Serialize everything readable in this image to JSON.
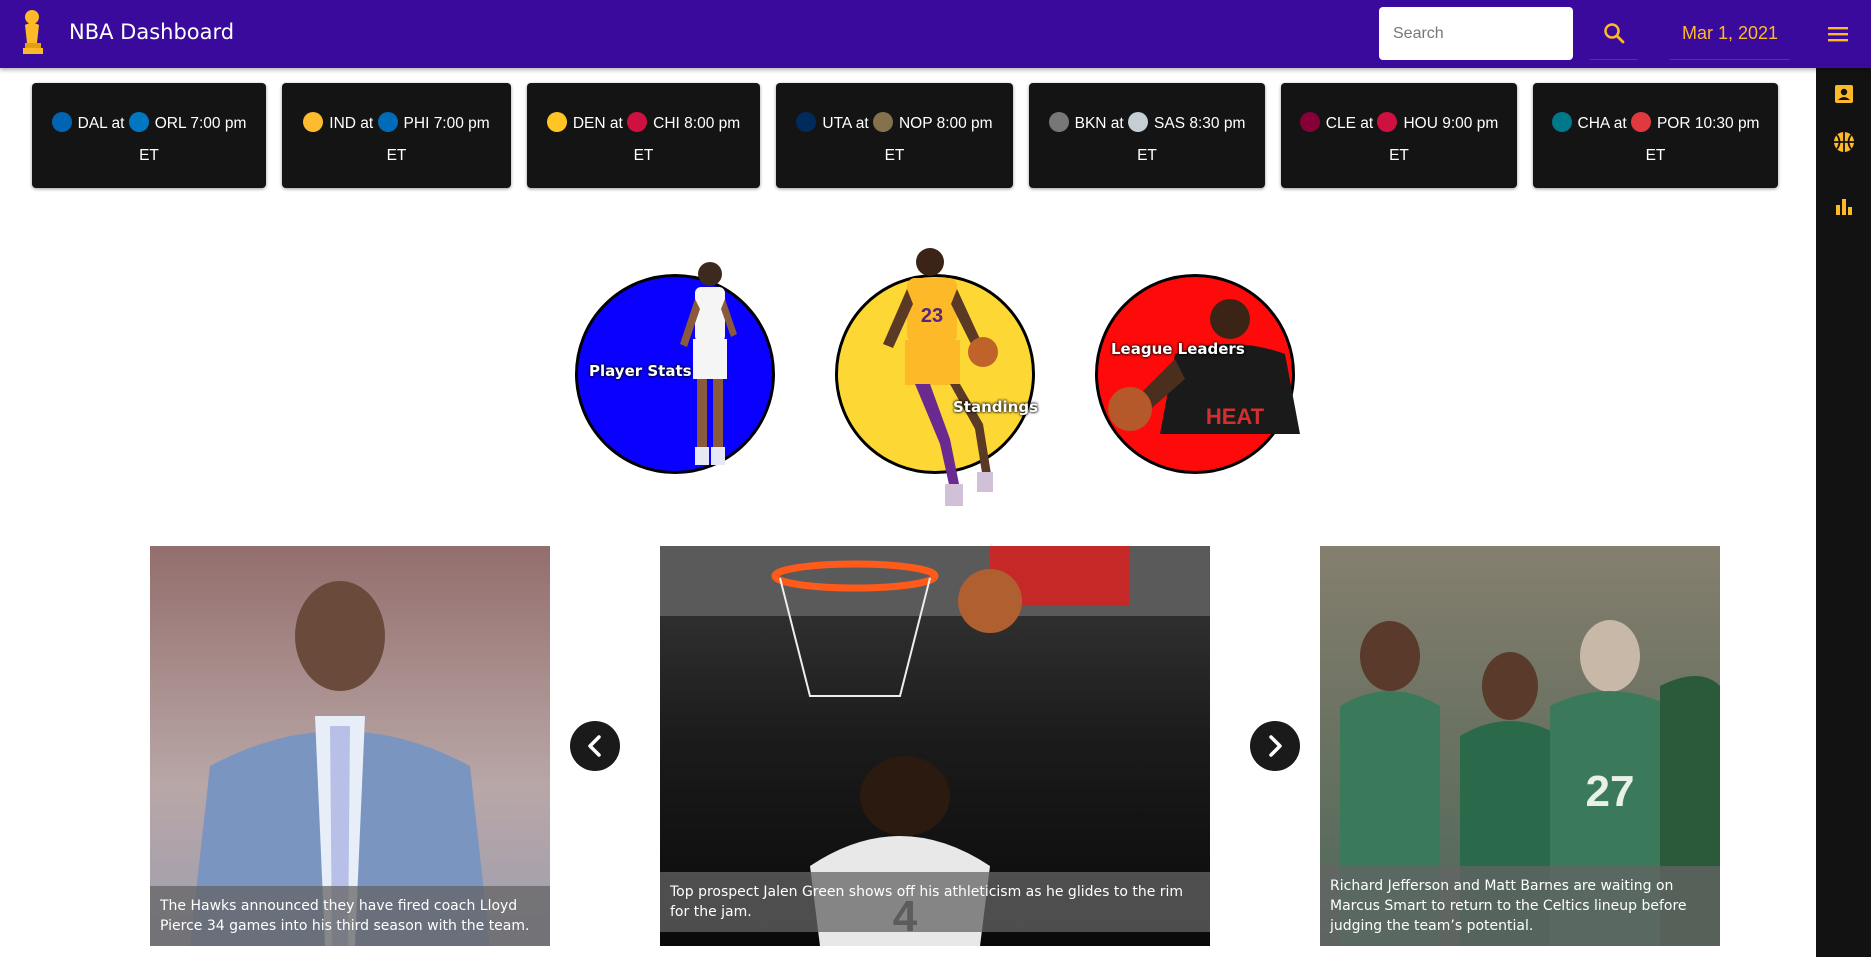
{
  "app": {
    "title": "NBA Dashboard"
  },
  "header": {
    "search_placeholder": "Search",
    "date": "Mar 1, 2021"
  },
  "games": [
    {
      "away": "DAL",
      "home": "ORL",
      "time": "7:00 pm",
      "tz": "ET",
      "away_color": "#0064b1",
      "home_color": "#0077c0"
    },
    {
      "away": "IND",
      "home": "PHI",
      "time": "7:00 pm",
      "tz": "ET",
      "away_color": "#fdbb30",
      "home_color": "#006bb6"
    },
    {
      "away": "DEN",
      "home": "CHI",
      "time": "8:00 pm",
      "tz": "ET",
      "away_color": "#fec524",
      "home_color": "#ce1141"
    },
    {
      "away": "UTA",
      "home": "NOP",
      "time": "8:00 pm",
      "tz": "ET",
      "away_color": "#002b5c",
      "home_color": "#85714d"
    },
    {
      "away": "BKN",
      "home": "SAS",
      "time": "8:30 pm",
      "tz": "ET",
      "away_color": "#777777",
      "home_color": "#c4ced4"
    },
    {
      "away": "CLE",
      "home": "HOU",
      "time": "9:00 pm",
      "tz": "ET",
      "away_color": "#860038",
      "home_color": "#ce1141"
    },
    {
      "away": "CHA",
      "home": "POR",
      "time": "10:30 pm",
      "tz": "ET",
      "away_color": "#00788c",
      "home_color": "#e03a3e"
    }
  ],
  "sections": [
    {
      "label": "Player Stats",
      "color": "#0a00ff"
    },
    {
      "label": "Standings",
      "color": "#fdd835"
    },
    {
      "label": "League Leaders",
      "color": "#ff0a0a"
    }
  ],
  "news": [
    {
      "caption": "The Hawks announced they have fired coach Lloyd Pierce 34 games into his third season with the team."
    },
    {
      "caption": "Top prospect Jalen Green shows off his athleticism as he glides to the rim for the jam."
    },
    {
      "caption": "Richard Jefferson and Matt Barnes are waiting on Marcus Smart to return to the Celtics lineup before judging the team’s potential."
    }
  ],
  "colors": {
    "header_bg": "#3a0a9c",
    "accent_gold": "#fdb927",
    "card_bg": "#141414",
    "sidebar_bg": "#121212"
  },
  "icons": {
    "logo": "trophy-logo",
    "search": "search-icon",
    "menu": "menu-icon",
    "sidebar": [
      "account-box-icon",
      "basketball-icon",
      "bar-chart-icon"
    ],
    "carousel": [
      "chevron-left-icon",
      "chevron-right-icon"
    ]
  }
}
